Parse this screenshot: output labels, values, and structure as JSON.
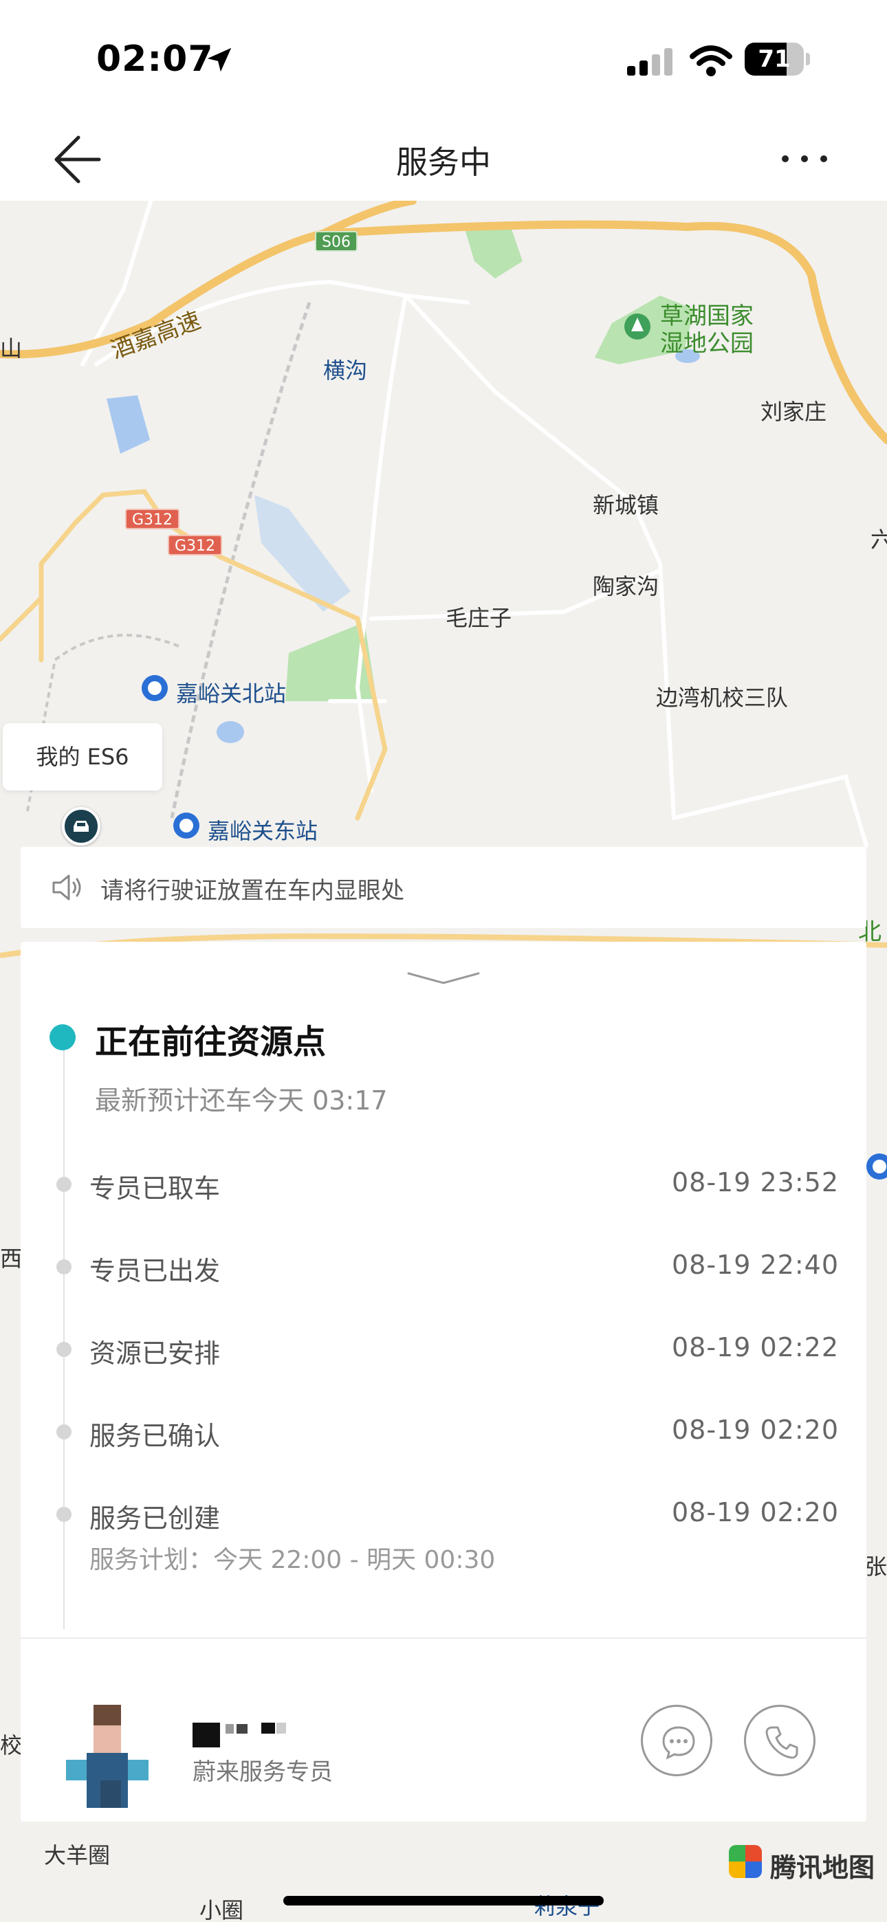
{
  "status_bar": {
    "time": "02:07",
    "battery": "71",
    "battery_level": 0.71
  },
  "nav": {
    "title": "服务中"
  },
  "map": {
    "labels": {
      "hengou": "横沟",
      "caohu": "草湖国家\n湿地公园",
      "liujiazhuang": "刘家庄",
      "xinchengzhen": "新城镇",
      "taojiagou": "陶家沟",
      "maozhuangzi": "毛庄子",
      "bianwan": "边湾机校三队",
      "jiayuguan_north": "嘉峪关北站",
      "jiayuguan_east": "嘉峪关东站",
      "jiujia": "酒嘉高速",
      "shan": "山",
      "liu": "六",
      "bei": "北",
      "xi": "西",
      "zhang": "张",
      "xiao": "校",
      "dayang": "大羊圈",
      "xiaoquan": "小圈",
      "liquanzi": "莉泉子"
    },
    "shields": {
      "s06": "S06",
      "g312a": "G312",
      "g312b": "G312"
    },
    "car_tag": "我的 ES6",
    "logo": "腾讯地图"
  },
  "notice": {
    "text": "请将行驶证放置在车内显眼处"
  },
  "progress": {
    "current_title": "正在前往资源点",
    "current_sub": "最新预计还车今天 03:17",
    "steps": [
      {
        "label": "专员已取车",
        "time": "08-19 23:52"
      },
      {
        "label": "专员已出发",
        "time": "08-19 22:40"
      },
      {
        "label": "资源已安排",
        "time": "08-19 02:22"
      },
      {
        "label": "服务已确认",
        "time": "08-19 02:20"
      },
      {
        "label": "服务已创建",
        "time": "08-19 02:20"
      }
    ],
    "plan": "服务计划：今天 22:00 - 明天 00:30"
  },
  "agent": {
    "role": "蔚来服务专员"
  },
  "colors": {
    "accent": "#1fb8c0",
    "map_bg": "#f2f1ee",
    "road_major": "#f3c46a"
  }
}
